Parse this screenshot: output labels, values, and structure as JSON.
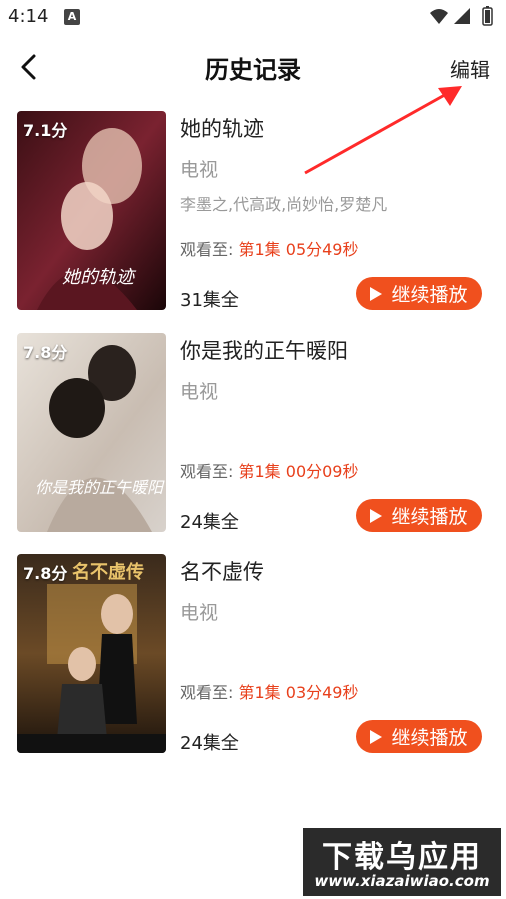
{
  "statusbar": {
    "time": "4:14"
  },
  "header": {
    "back_icon": "chevron-left-icon",
    "title": "历史记录",
    "edit_label": "编辑"
  },
  "items": [
    {
      "score": "7.1分",
      "title": "她的轨迹",
      "genre": "电视",
      "cast": "李墨之,代高政,尚妙怡,罗楚凡",
      "progress_label": "观看至:",
      "progress_value": "第1集 05分49秒",
      "episodes": "31集全",
      "play_label": "继续播放",
      "poster_text": "她的轨迹"
    },
    {
      "score": "7.8分",
      "title": "你是我的正午暖阳",
      "genre": "电视",
      "cast": "",
      "progress_label": "观看至:",
      "progress_value": "第1集 00分09秒",
      "episodes": "24集全",
      "play_label": "继续播放",
      "poster_text": "你是我的正午暖阳"
    },
    {
      "score": "7.8分",
      "title": "名不虚传",
      "genre": "电视",
      "cast": "",
      "progress_label": "观看至:",
      "progress_value": "第1集 03分49秒",
      "episodes": "24集全",
      "play_label": "继续播放",
      "poster_text": "名不虚传"
    }
  ],
  "watermark": {
    "top": "下载乌应用",
    "bottom": "www.xiazaiwiao.com"
  },
  "colors": {
    "accent": "#f0501e",
    "progress": "#e8401c",
    "annotation_arrow": "#ff2a2a"
  }
}
